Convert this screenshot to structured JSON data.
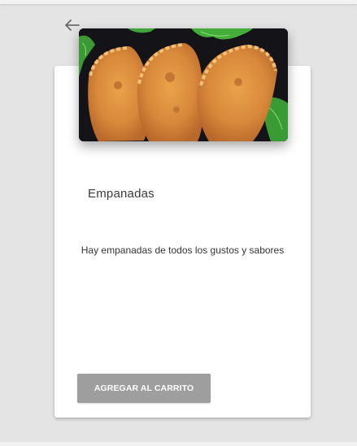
{
  "header": {
    "back_icon": "arrow-left-icon"
  },
  "product": {
    "title": "Empanadas",
    "description": "Hay empanadas de todos los gustos y sabores",
    "image_icon": "empanadas-photo",
    "add_to_cart_label": "AGREGAR AL CARRITO"
  },
  "colors": {
    "background": "#e4e4e4",
    "card": "#ffffff",
    "button": "#9e9e9e",
    "button_text": "#ffffff"
  }
}
